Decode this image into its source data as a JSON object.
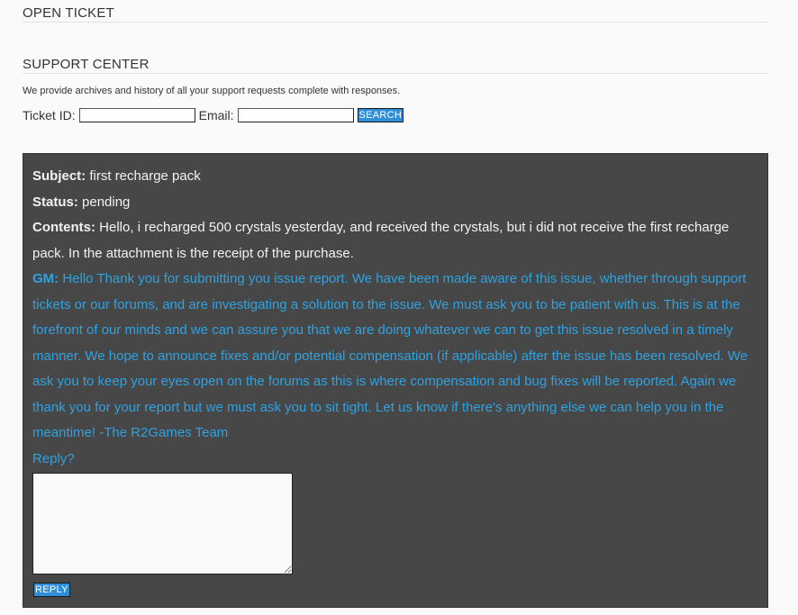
{
  "open_ticket": {
    "title": "OPEN TICKET"
  },
  "support_center": {
    "title": "SUPPORT CENTER",
    "description": "We provide archives and history of all your support requests complete with responses.",
    "ticket_id_label": "Ticket ID:",
    "ticket_id_value": "",
    "email_label": "Email:",
    "email_value": "",
    "search_button": "SEARCH"
  },
  "ticket": {
    "subject_label": "Subject:",
    "subject_value": "first recharge pack",
    "status_label": "Status:",
    "status_value": "pending",
    "contents_label": "Contents:",
    "contents_value": "Hello, i recharged 500 crystals yesterday, and received the crystals, but i did not receive the first recharge pack. In the attachment is the receipt of the purchase.",
    "gm_label": "GM:",
    "gm_value": "Hello Thank you for submitting you issue report. We have been made aware of this issue, whether through support tickets or our forums, and are investigating a solution to the issue. We must ask you to be patient with us. This is at the forefront of our minds and we can assure you that we are doing whatever we can to get this issue resolved in a timely manner. We hope to announce fixes and/or potential compensation (if applicable) after the issue has been resolved. We ask you to keep your eyes open on the forums as this is where compensation and bug fixes will be reported. Again we thank you for your report but we must ask you to sit tight. Let us know if there's anything else we can help you in the meantime! -The R2Games Team",
    "reply_prompt": "Reply?",
    "reply_value": "",
    "reply_button": "REPLY"
  },
  "colors": {
    "page_background": "#fafafa",
    "panel_background": "#474747",
    "gm_text": "#2fa2e0",
    "button_background": "#2f8fd6"
  }
}
